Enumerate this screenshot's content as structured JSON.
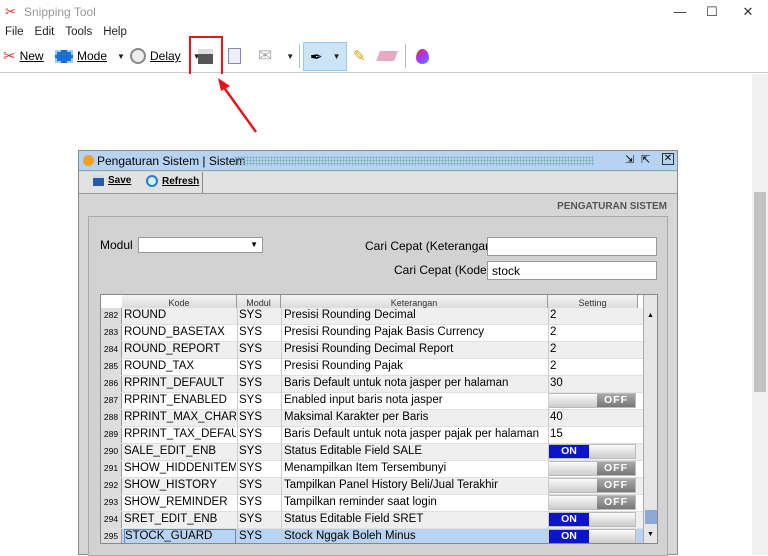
{
  "app": {
    "title": "Snipping Tool",
    "minimize": "—",
    "maximize": "☐",
    "close": "✕"
  },
  "menu": [
    "File",
    "Edit",
    "Tools",
    "Help"
  ],
  "toolbar": {
    "new": "New",
    "mode": "Mode",
    "delay": "Delay"
  },
  "colors": {
    "highlight": "#e8141c",
    "toggle_on": "#0b14c8",
    "selected_row": "#b8d4f2"
  },
  "inner": {
    "title": "Pengaturan Sistem | Sistem",
    "save": "Save",
    "refresh": "Refresh",
    "heading": "PENGATURAN SISTEM",
    "modul_label": "Modul",
    "modul_value": "",
    "cari_ket_label": "Cari Cepat (Keterangan)",
    "cari_ket_value": "",
    "cari_kode_label": "Cari Cepat (Kode)",
    "cari_kode_value": "stock",
    "columns": [
      "Kode",
      "Modul",
      "Keterangan",
      "Setting"
    ],
    "rows": [
      {
        "n": "282",
        "kode": "ROUND",
        "modul": "SYS",
        "ket": "Presisi Rounding Decimal",
        "setting": "2"
      },
      {
        "n": "283",
        "kode": "ROUND_BASETAX",
        "modul": "SYS",
        "ket": "Presisi Rounding Pajak Basis Currency",
        "setting": "2"
      },
      {
        "n": "284",
        "kode": "ROUND_REPORT",
        "modul": "SYS",
        "ket": "Presisi Rounding Decimal Report",
        "setting": "2"
      },
      {
        "n": "285",
        "kode": "ROUND_TAX",
        "modul": "SYS",
        "ket": "Presisi Rounding Pajak",
        "setting": "2"
      },
      {
        "n": "286",
        "kode": "RPRINT_DEFAULT",
        "modul": "SYS",
        "ket": "Baris Default untuk nota jasper per halaman",
        "setting": "30"
      },
      {
        "n": "287",
        "kode": "RPRINT_ENABLED",
        "modul": "SYS",
        "ket": "Enabled input baris nota jasper",
        "setting": "OFF"
      },
      {
        "n": "288",
        "kode": "RPRINT_MAX_CHAR",
        "modul": "SYS",
        "ket": "Maksimal Karakter per Baris",
        "setting": "40"
      },
      {
        "n": "289",
        "kode": "RPRINT_TAX_DEFAULT",
        "modul": "SYS",
        "ket": "Baris Default untuk nota jasper pajak per halaman",
        "setting": "15"
      },
      {
        "n": "290",
        "kode": "SALE_EDIT_ENB",
        "modul": "SYS",
        "ket": "Status Editable Field SALE",
        "setting": "ON"
      },
      {
        "n": "291",
        "kode": "SHOW_HIDDENITEM",
        "modul": "SYS",
        "ket": "Menampilkan Item Tersembunyi",
        "setting": "OFF"
      },
      {
        "n": "292",
        "kode": "SHOW_HISTORY",
        "modul": "SYS",
        "ket": "Tampilkan Panel History Beli/Jual Terakhir",
        "setting": "OFF"
      },
      {
        "n": "293",
        "kode": "SHOW_REMINDER",
        "modul": "SYS",
        "ket": "Tampilkan reminder saat login",
        "setting": "OFF"
      },
      {
        "n": "294",
        "kode": "SRET_EDIT_ENB",
        "modul": "SYS",
        "ket": "Status Editable Field SRET",
        "setting": "ON"
      },
      {
        "n": "295",
        "kode": "STOCK_GUARD",
        "modul": "SYS",
        "ket": "Stock Nggak Boleh Minus",
        "setting": "ON",
        "selected": true
      }
    ]
  }
}
